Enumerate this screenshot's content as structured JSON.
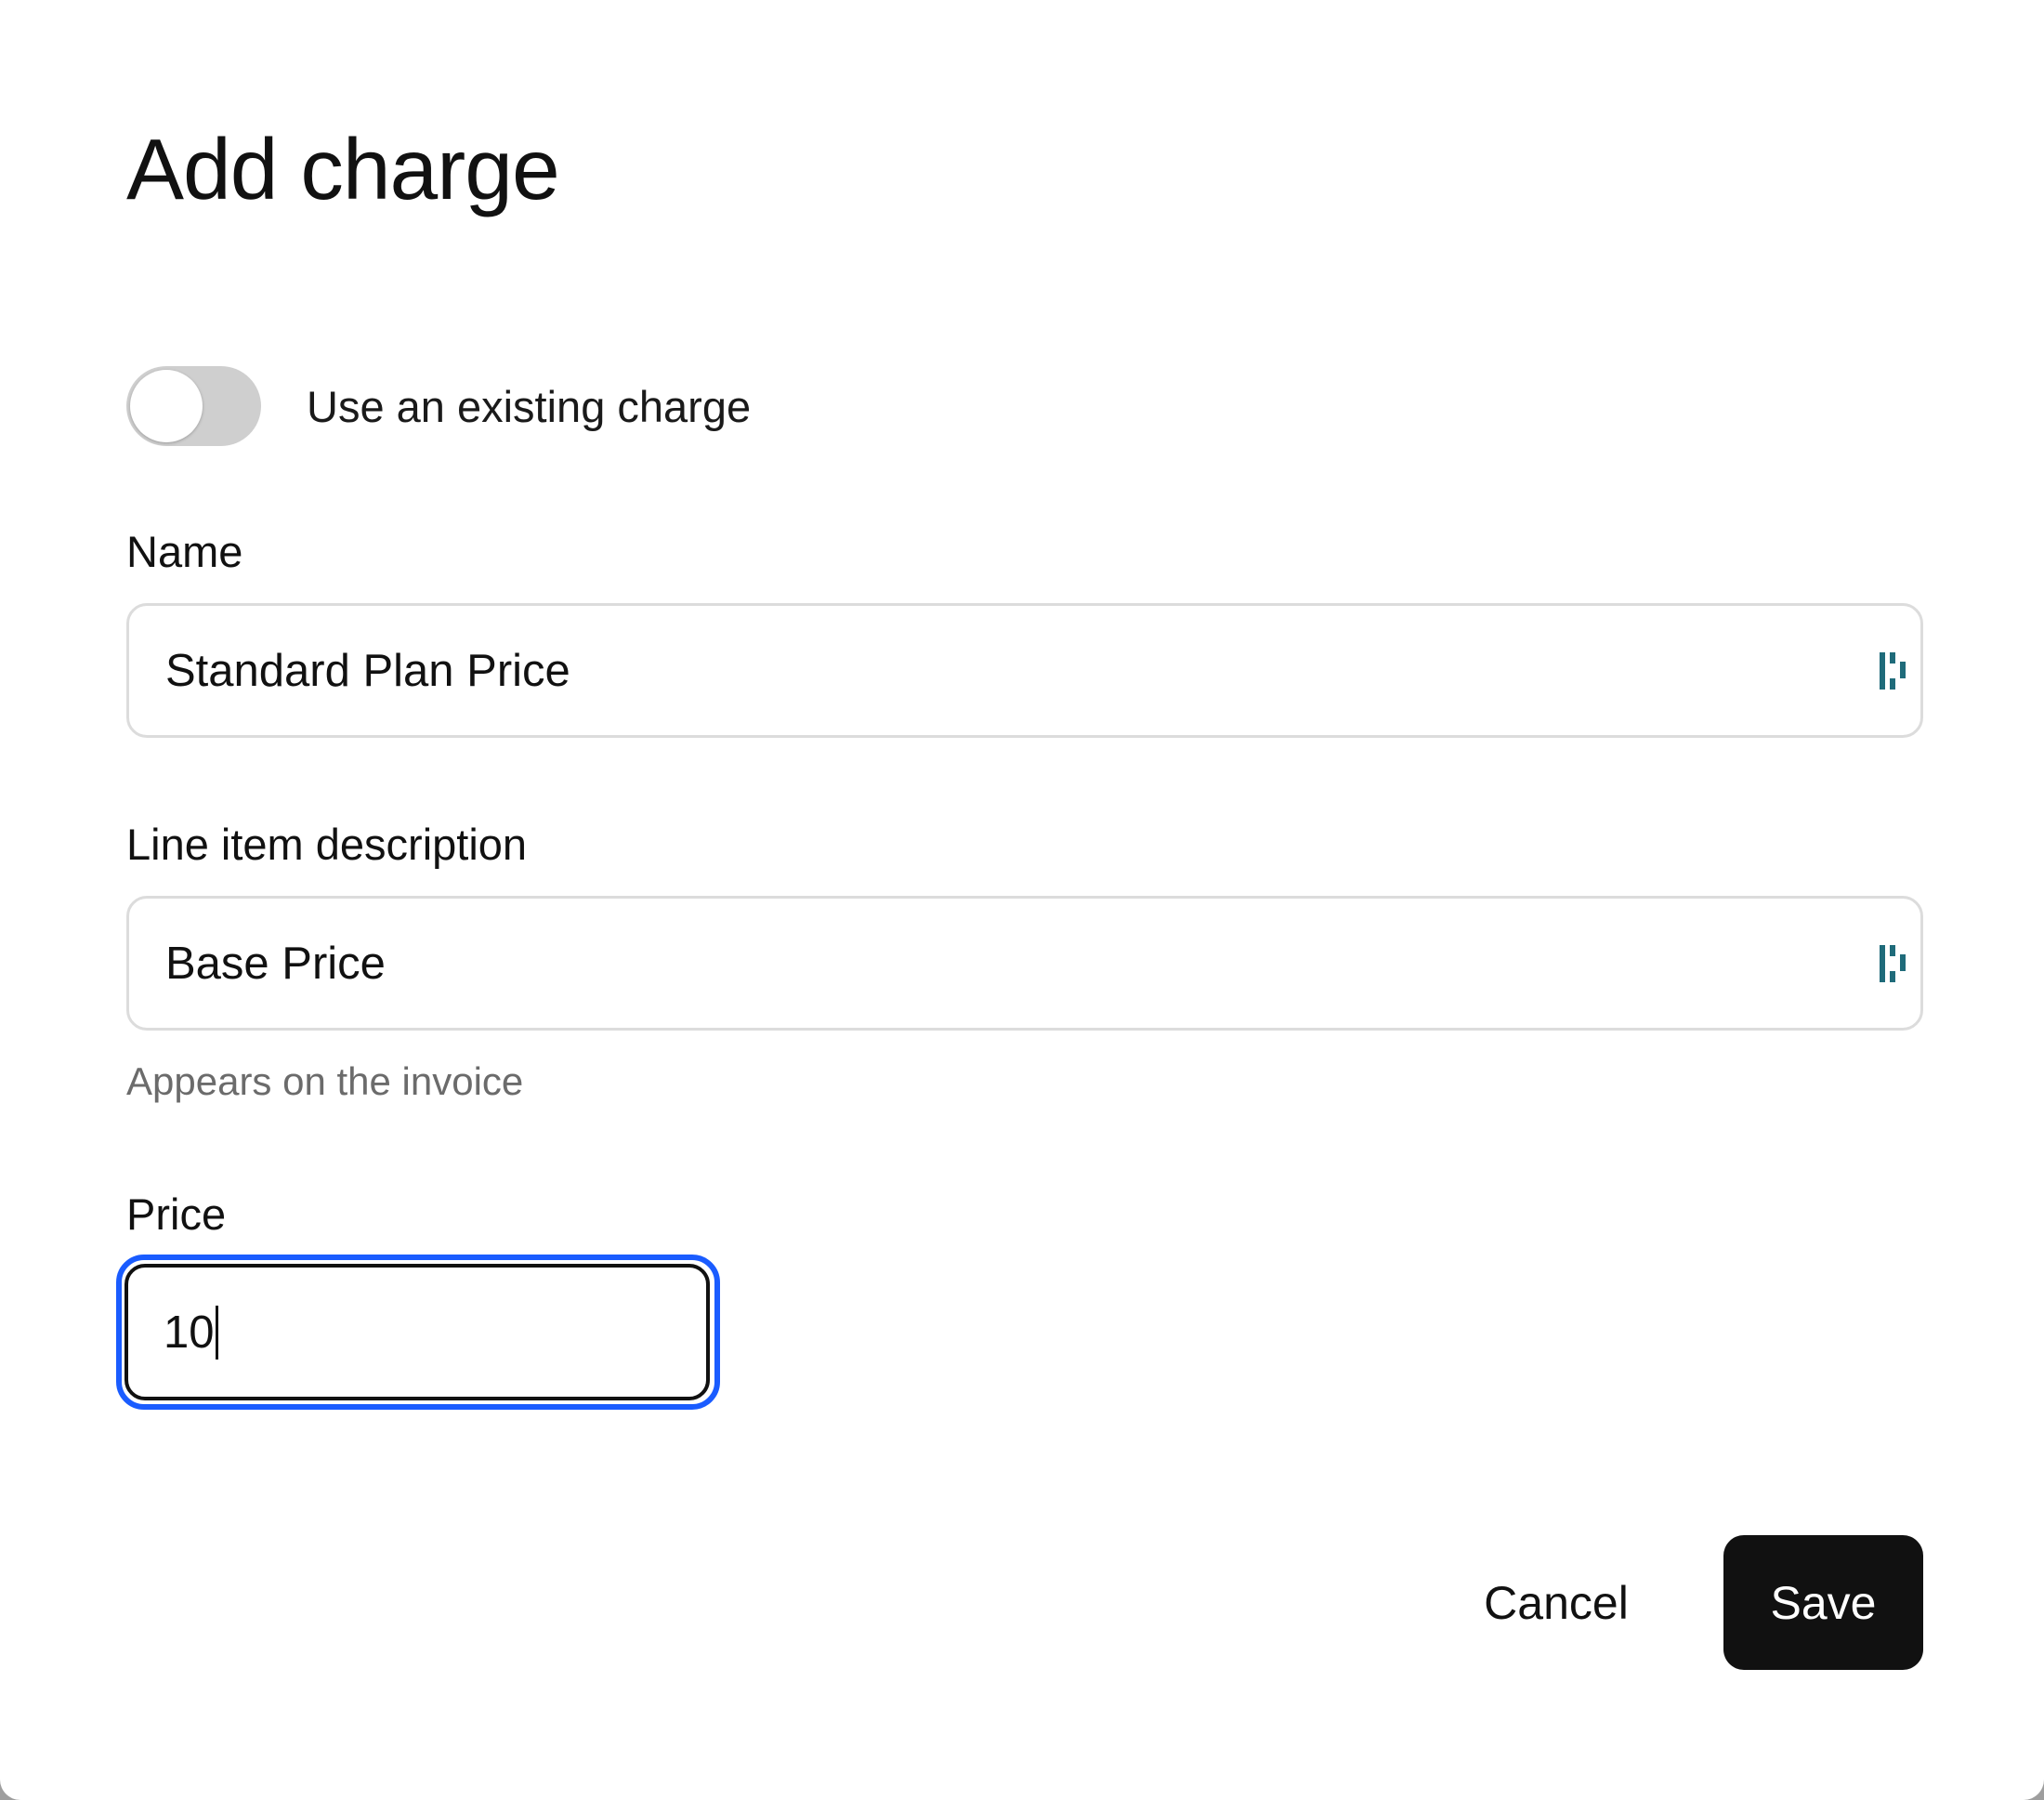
{
  "dialog": {
    "title": "Add charge"
  },
  "toggle": {
    "label": "Use an existing charge",
    "state": "off"
  },
  "fields": {
    "name": {
      "label": "Name",
      "value": "Standard Plan Price",
      "icon": "variable-insert-icon"
    },
    "line_item": {
      "label": "Line item description",
      "value": "Base Price",
      "helper": "Appears on the invoice",
      "icon": "variable-insert-icon"
    },
    "price": {
      "label": "Price",
      "value": "10"
    }
  },
  "actions": {
    "cancel_label": "Cancel",
    "save_label": "Save"
  },
  "colors": {
    "focus_ring": "#1a5cff",
    "primary_button": "#111111",
    "field_icon": "#1f6b7a",
    "toggle_off": "#cfcfcf"
  }
}
